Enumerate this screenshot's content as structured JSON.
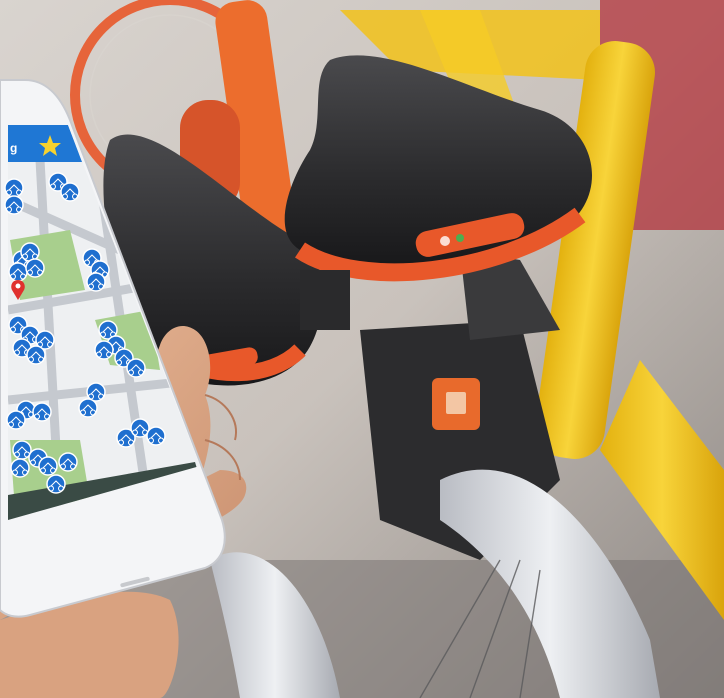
{
  "scene": {
    "description_free": true,
    "colors": {
      "bike_orange": "#e8582a",
      "bike_yellow": "#f2c21a",
      "saddle_black": "#2b2b2d",
      "fender_silver": "#d9dbe0",
      "app_header_blue": "#1f77d4",
      "map_green": "#a8cf8d",
      "bike_pin_blue": "#1f6fcf",
      "location_pin_red": "#e0312e"
    }
  },
  "phone": {
    "header_text": "g",
    "star_icon": "star-icon",
    "bottom_bar_icon": "map-icon"
  }
}
